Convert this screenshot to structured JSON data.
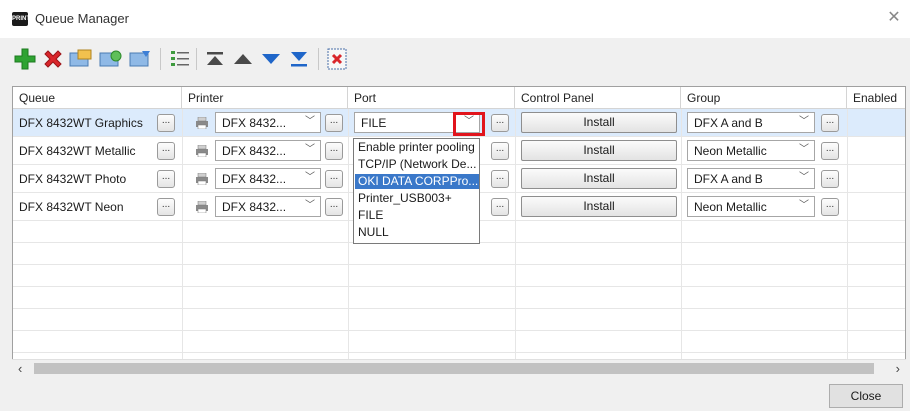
{
  "window": {
    "title": "Queue Manager",
    "app_icon_text": "PRINT"
  },
  "toolbar": {
    "buttons": [
      "add-icon",
      "delete-icon",
      "queue-folder-icon",
      "queue-refresh-icon",
      "queue-import-icon",
      "list-properties-icon",
      "move-top-icon",
      "move-up-icon",
      "move-down-icon",
      "move-bottom-icon",
      "clear-all-icon"
    ]
  },
  "columns": {
    "queue": "Queue",
    "printer": "Printer",
    "port": "Port",
    "control_panel": "Control Panel",
    "group": "Group",
    "enabled": "Enabled"
  },
  "rows": [
    {
      "queue": "DFX 8432WT Graphics",
      "printer": "DFX 8432...",
      "port": "FILE",
      "control_panel": "Install",
      "group": "DFX A and B",
      "selected": true
    },
    {
      "queue": "DFX 8432WT Metallic",
      "printer": "DFX 8432...",
      "port": "",
      "control_panel": "Install",
      "group": "Neon Metallic",
      "selected": false
    },
    {
      "queue": "DFX 8432WT Photo",
      "printer": "DFX 8432...",
      "port": "",
      "control_panel": "Install",
      "group": "DFX A and B",
      "selected": false
    },
    {
      "queue": "DFX 8432WT Neon",
      "printer": "DFX 8432...",
      "port": "",
      "control_panel": "Install",
      "group": "Neon Metallic",
      "selected": false
    }
  ],
  "ellipsis_label": "...",
  "port_dropdown": {
    "options": [
      "Enable printer pooling",
      "TCP/IP (Network De...",
      "OKI DATA CORPPro...",
      "Printer_USB003+",
      "FILE",
      "NULL"
    ],
    "highlighted": "OKI DATA CORPPro..."
  },
  "footer": {
    "close_label": "Close"
  },
  "colors": {
    "selection": "#dcebfc",
    "highlight": "#3a78c9",
    "callout": "#e1141c"
  }
}
